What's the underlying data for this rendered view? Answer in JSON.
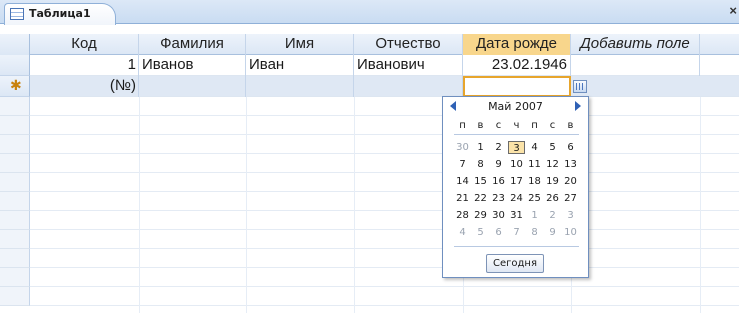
{
  "tab": {
    "title": "Таблица1",
    "close": "×"
  },
  "columns": [
    "Код",
    "Фамилия",
    "Имя",
    "Отчество",
    "Дата рожде",
    "Добавить поле"
  ],
  "row1": {
    "id": "1",
    "last": "Иванов",
    "first": "Иван",
    "middle": "Иванович",
    "birth": "23.02.1946"
  },
  "new_row": {
    "marker": "✱",
    "id": "(№)"
  },
  "calendar": {
    "title": "Май 2007",
    "weekdays": [
      "п",
      "в",
      "с",
      "ч",
      "п",
      "с",
      "в"
    ],
    "weeks": [
      [
        "30",
        "1",
        "2",
        "3",
        "4",
        "5",
        "6"
      ],
      [
        "7",
        "8",
        "9",
        "10",
        "11",
        "12",
        "13"
      ],
      [
        "14",
        "15",
        "16",
        "17",
        "18",
        "19",
        "20"
      ],
      [
        "21",
        "22",
        "23",
        "24",
        "25",
        "26",
        "27"
      ],
      [
        "28",
        "29",
        "30",
        "31",
        "1",
        "2",
        "3"
      ],
      [
        "4",
        "5",
        "6",
        "7",
        "8",
        "9",
        "10"
      ]
    ],
    "other_month": [
      [
        0,
        0
      ],
      [
        4,
        4
      ],
      [
        4,
        5
      ],
      [
        4,
        6
      ],
      [
        5,
        0
      ],
      [
        5,
        1
      ],
      [
        5,
        2
      ],
      [
        5,
        3
      ],
      [
        5,
        4
      ],
      [
        5,
        5
      ],
      [
        5,
        6
      ]
    ],
    "selected": [
      0,
      3
    ],
    "today_label": "Сегодня"
  },
  "colors": {
    "accent": "#e7a52c",
    "header": "#dce7f5",
    "new_row": "#dfe8f4"
  }
}
